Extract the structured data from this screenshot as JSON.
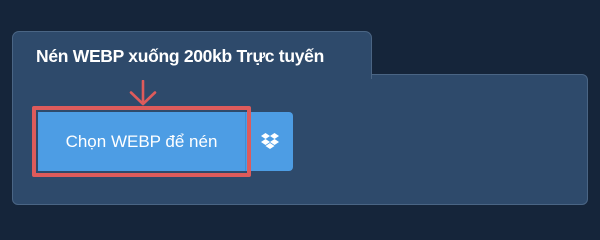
{
  "tab": {
    "title": "Nén WEBP xuống 200kb Trực tuyến"
  },
  "upload": {
    "choose_label": "Chọn WEBP để nén",
    "dropbox_icon": "dropbox-icon"
  },
  "colors": {
    "background": "#15253a",
    "panel": "#2e4a6b",
    "button": "#4d9de4",
    "highlight": "#de5b5b"
  }
}
